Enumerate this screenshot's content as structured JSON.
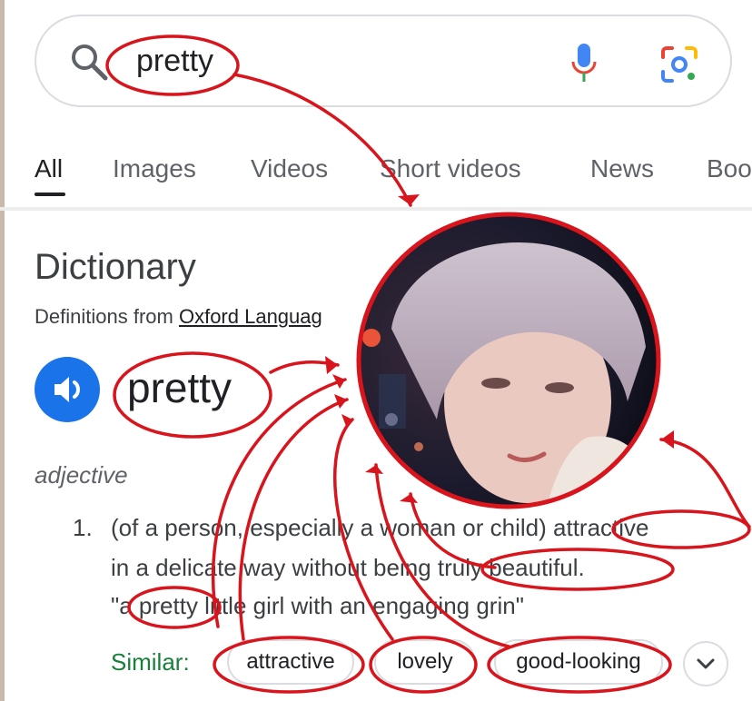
{
  "search": {
    "query": "pretty"
  },
  "tabs": [
    {
      "label": "All",
      "active": true
    },
    {
      "label": "Images",
      "active": false
    },
    {
      "label": "Videos",
      "active": false
    },
    {
      "label": "Short videos",
      "active": false
    },
    {
      "label": "News",
      "active": false
    },
    {
      "label": "Boo",
      "active": false
    }
  ],
  "dictionary": {
    "title": "Dictionary",
    "source_prefix": "Definitions from",
    "source_link": "Oxford Languag",
    "word": "pretty",
    "part_of_speech": "adjective",
    "definition": {
      "number": "1.",
      "line1": "(of a person, especially a woman or child) attractive",
      "line2": "in a delicate way without being truly beautiful.",
      "example": "\"a pretty little girl with an engaging grin\""
    },
    "similar_label": "Similar:",
    "similar": [
      "attractive",
      "lovely",
      "good-looking"
    ]
  },
  "icons": [
    "search-icon",
    "mic-icon",
    "lens-icon",
    "speaker-icon",
    "chevron-down-icon"
  ],
  "colors": {
    "annotation_red": "#d8141c",
    "link_blue": "#1a73e8",
    "similar_green": "#188038"
  }
}
